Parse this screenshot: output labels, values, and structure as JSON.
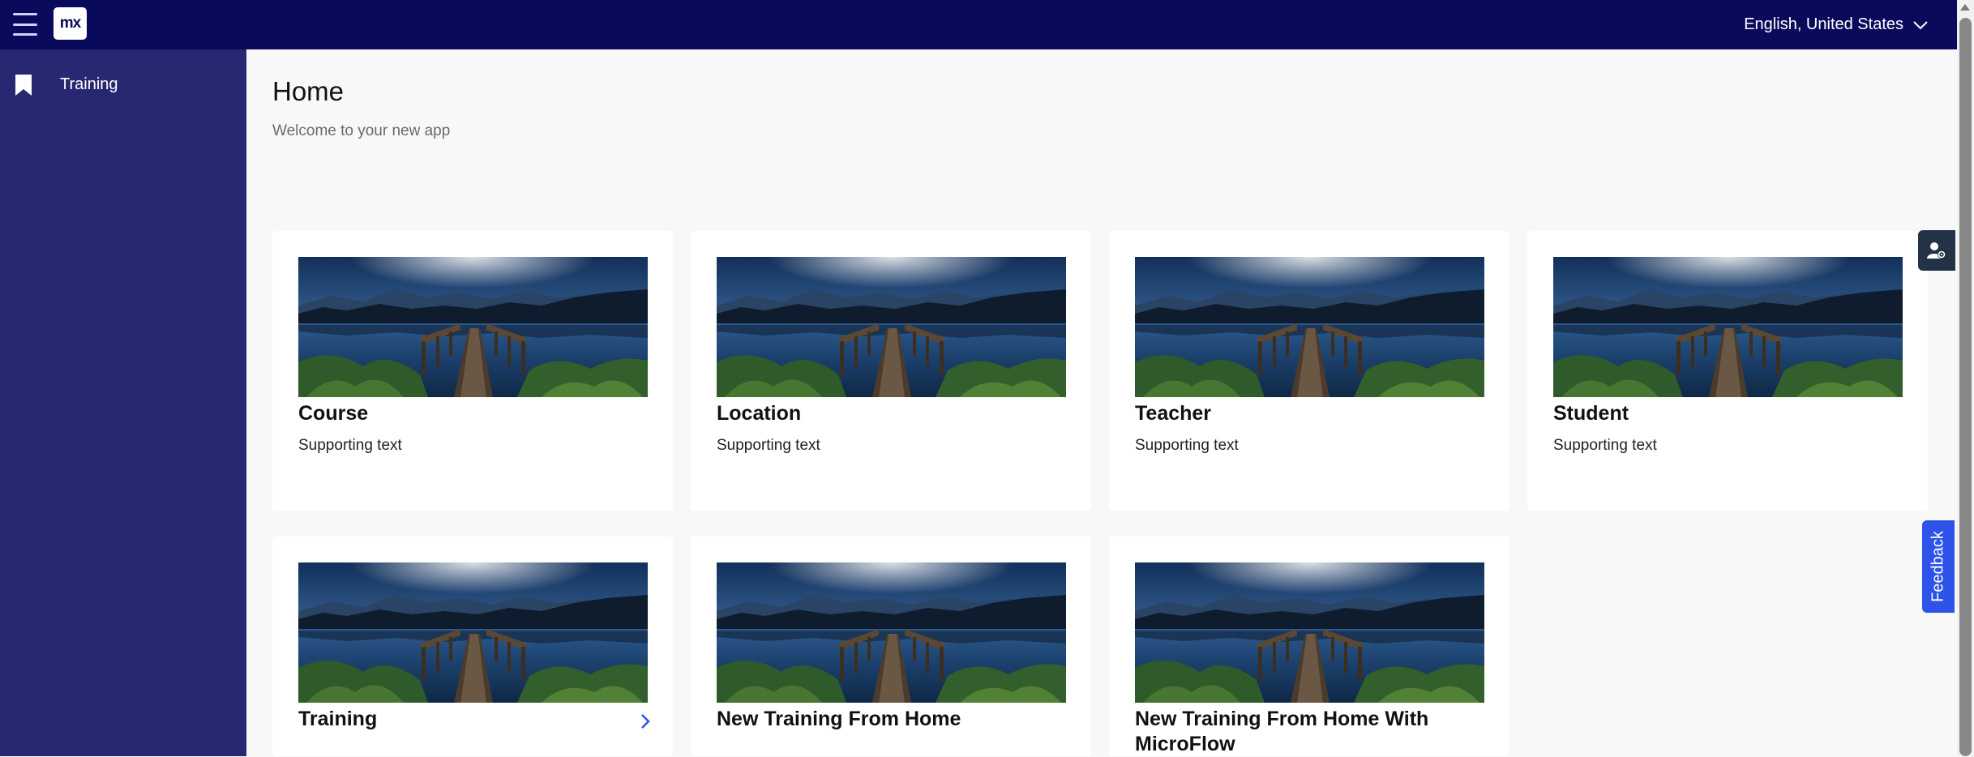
{
  "header": {
    "logo_text": "mx",
    "language": "English, United States"
  },
  "sidebar": {
    "items": [
      {
        "label": "Training",
        "icon": "bookmark-icon"
      }
    ]
  },
  "page": {
    "title": "Home",
    "subtitle": "Welcome to your new app"
  },
  "cards": [
    {
      "title": "Course",
      "support": "Supporting text"
    },
    {
      "title": "Location",
      "support": "Supporting text"
    },
    {
      "title": "Teacher",
      "support": "Supporting text"
    },
    {
      "title": "Student",
      "support": "Supporting text"
    },
    {
      "title": "Training",
      "icon": "chevron-right-icon"
    },
    {
      "title": "New Training From Home"
    },
    {
      "title": "New Training From Home With MicroFlow"
    }
  ],
  "feedback": {
    "label": "Feedback"
  },
  "colors": {
    "topbar": "#0a0a5c",
    "sidebar": "#282872",
    "accent": "#2e53e8",
    "background": "#f8f8f8"
  }
}
